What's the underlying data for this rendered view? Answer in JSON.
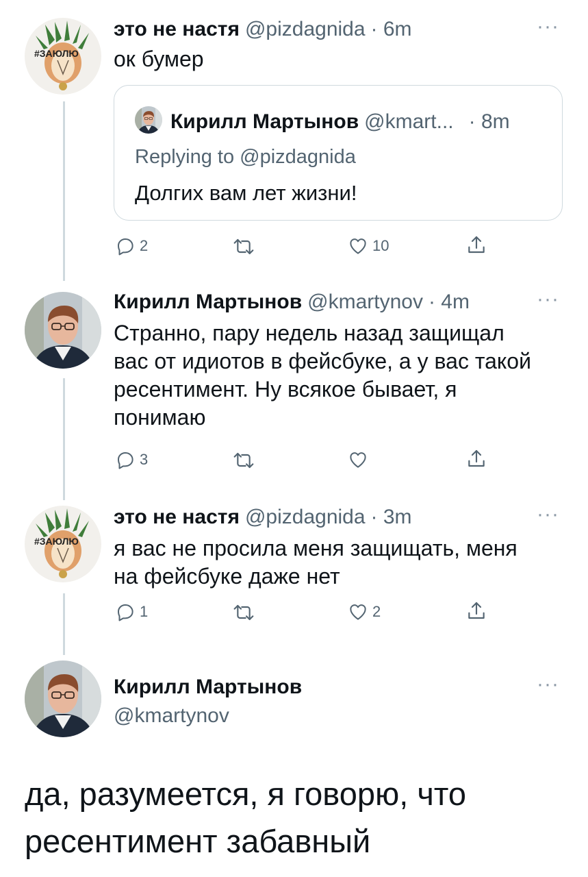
{
  "tweets": [
    {
      "name": "это не настя",
      "handle": "@pizdagnida",
      "time": "· 6m",
      "text": "ок бумер",
      "avatar_text": "#ЗАЮЛЮ",
      "quote": {
        "name": "Кирилл Мартынов",
        "handle": "@kmart...",
        "time": "· 8m",
        "replying": "Replying to @pizdagnida",
        "text": "Долгих вам лет жизни!"
      },
      "actions": {
        "replies": "2",
        "retweets": "",
        "likes": "10"
      }
    },
    {
      "name": "Кирилл Мартынов",
      "handle": "@kmartynov",
      "time": "· 4m",
      "text_lines": [
        "Странно, пару недель назад защищал",
        "вас от идиотов в фейсбуке, а у вас такой",
        "ресентимент. Ну всякое бывает, я",
        "понимаю"
      ],
      "actions": {
        "replies": "3",
        "retweets": "",
        "likes": ""
      }
    },
    {
      "name": "это не настя",
      "handle": "@pizdagnida",
      "time": "· 3m",
      "text_lines": [
        "я вас не просила меня защищать, меня",
        "на фейсбуке даже нет"
      ],
      "avatar_text": "#ЗАЮЛЮ",
      "actions": {
        "replies": "1",
        "retweets": "",
        "likes": "2"
      }
    },
    {
      "name": "Кирилл Мартынов",
      "handle": "@kmartynov",
      "text_lines": [
        "да, разумеется, я говорю, что",
        "ресентимент забавный"
      ]
    }
  ],
  "icons": {
    "more": "more-dots-icon",
    "reply": "reply-icon",
    "retweet": "retweet-icon",
    "like": "heart-icon",
    "share": "share-icon"
  },
  "colors": {
    "text": "#0f1419",
    "secondary": "#536471",
    "border": "#cfd9de"
  }
}
